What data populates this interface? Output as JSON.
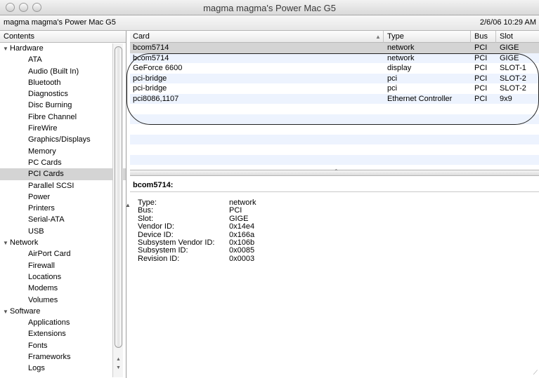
{
  "window": {
    "title": "magma magma's Power Mac G5"
  },
  "infobar": {
    "machine_name": "magma magma's Power Mac G5",
    "datetime": "2/6/06 10:29 AM"
  },
  "sidebar": {
    "header": "Contents",
    "groups": [
      {
        "label": "Hardware",
        "items": [
          "ATA",
          "Audio (Built In)",
          "Bluetooth",
          "Diagnostics",
          "Disc Burning",
          "Fibre Channel",
          "FireWire",
          "Graphics/Displays",
          "Memory",
          "PC Cards",
          "PCI Cards",
          "Parallel SCSI",
          "Power",
          "Printers",
          "Serial-ATA",
          "USB"
        ]
      },
      {
        "label": "Network",
        "items": [
          "AirPort Card",
          "Firewall",
          "Locations",
          "Modems",
          "Volumes"
        ]
      },
      {
        "label": "Software",
        "items": [
          "Applications",
          "Extensions",
          "Fonts",
          "Frameworks",
          "Logs"
        ]
      }
    ],
    "selected_item": "PCI Cards"
  },
  "table": {
    "columns": {
      "card": "Card",
      "type": "Type",
      "bus": "Bus",
      "slot": "Slot"
    },
    "rows": [
      {
        "card": "bcom5714",
        "type": "network",
        "bus": "PCI",
        "slot": "GIGE"
      },
      {
        "card": "bcom5714",
        "type": "network",
        "bus": "PCI",
        "slot": "GIGE"
      },
      {
        "card": "GeForce 6600",
        "type": "display",
        "bus": "PCI",
        "slot": "SLOT-1"
      },
      {
        "card": "pci-bridge",
        "type": "pci",
        "bus": "PCI",
        "slot": "SLOT-2"
      },
      {
        "card": "pci-bridge",
        "type": "pci",
        "bus": "PCI",
        "slot": "SLOT-2"
      },
      {
        "card": "pci8086,1107",
        "type": "Ethernet Controller",
        "bus": "PCI",
        "slot": "9x9"
      },
      {
        "card": "",
        "type": "",
        "bus": "",
        "slot": ""
      },
      {
        "card": "",
        "type": "",
        "bus": "",
        "slot": ""
      },
      {
        "card": "",
        "type": "",
        "bus": "",
        "slot": ""
      },
      {
        "card": "",
        "type": "",
        "bus": "",
        "slot": ""
      },
      {
        "card": "",
        "type": "",
        "bus": "",
        "slot": ""
      },
      {
        "card": "",
        "type": "",
        "bus": "",
        "slot": ""
      }
    ],
    "selected_row": 0
  },
  "detail": {
    "title": "bcom5714:",
    "properties": [
      {
        "key": "Type:",
        "value": "network"
      },
      {
        "key": "Bus:",
        "value": "PCI"
      },
      {
        "key": "Slot:",
        "value": "GIGE"
      },
      {
        "key": "Vendor ID:",
        "value": "0x14e4"
      },
      {
        "key": "Device ID:",
        "value": "0x166a"
      },
      {
        "key": "Subsystem Vendor ID:",
        "value": "0x106b"
      },
      {
        "key": "Subsystem ID:",
        "value": "0x0085"
      },
      {
        "key": "Revision ID:",
        "value": "0x0003"
      }
    ]
  },
  "colors": {
    "selection": "#d4d4d4",
    "stripe": "#edf3fe",
    "annotation_oval": "#222222"
  },
  "icons": {
    "close": "close-button-icon",
    "minimize": "minimize-button-icon",
    "zoom": "zoom-button-icon",
    "disclosure": "disclosure-triangle-icon",
    "sort": "sort-ascending-icon"
  }
}
